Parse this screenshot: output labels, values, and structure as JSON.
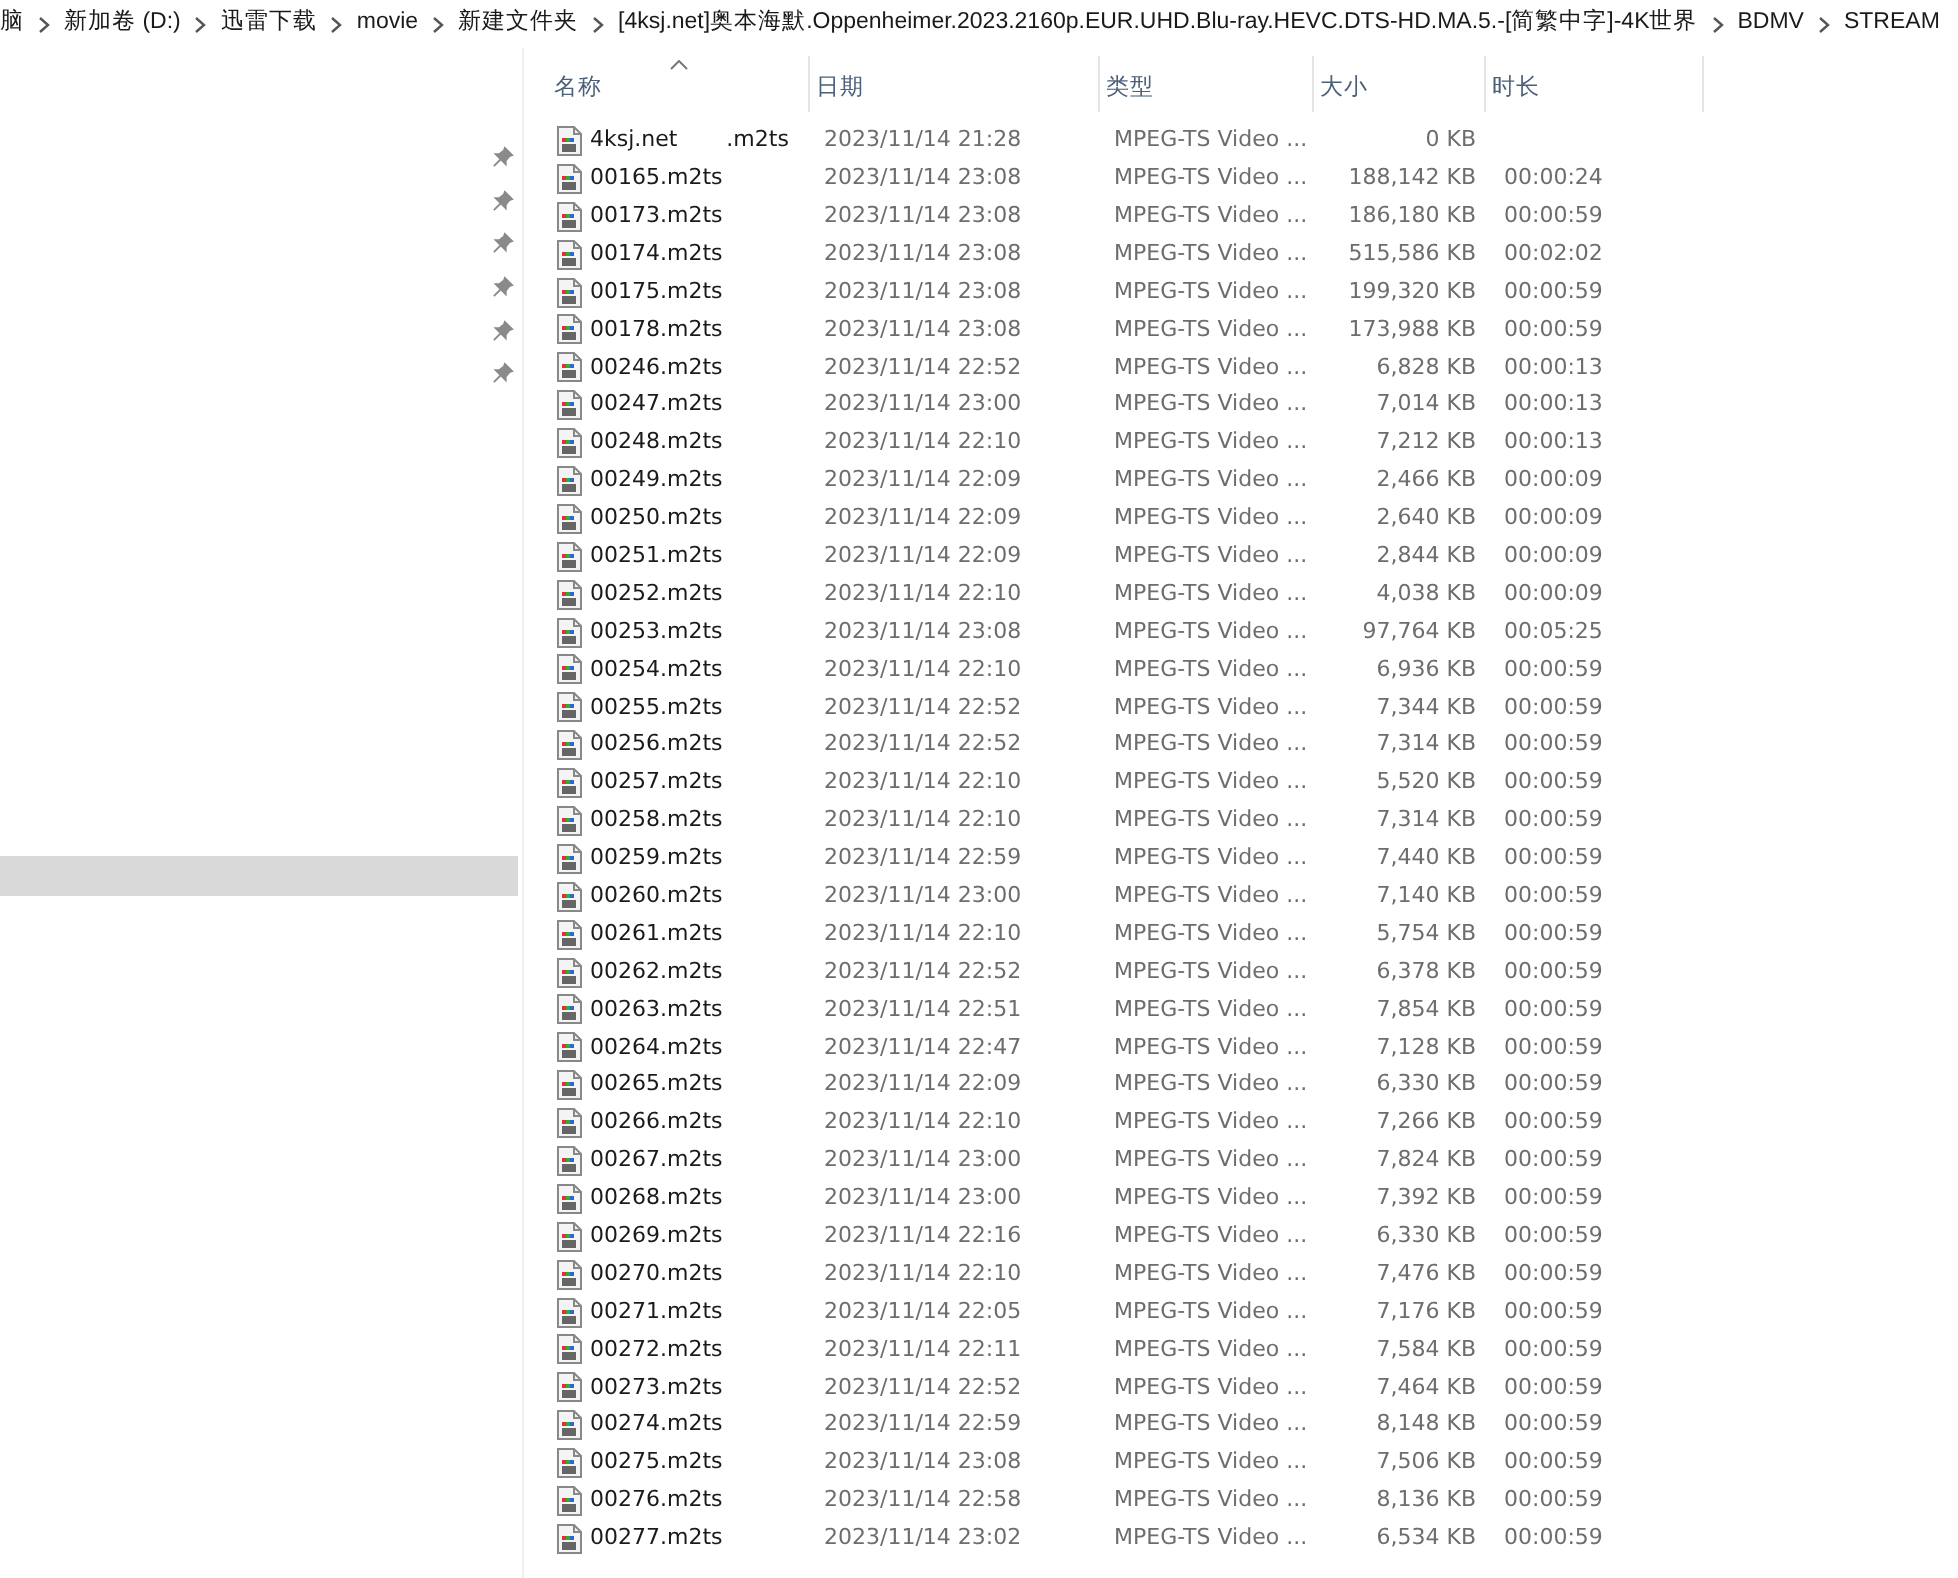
{
  "breadcrumb": [
    "脑",
    "新加卷 (D:)",
    "迅雷下载",
    "movie",
    "新建文件夹",
    "[4ksj.net]奥本海默.Oppenheimer.2023.2160p.EUR.UHD.Blu-ray.HEVC.DTS-HD.MA.5.-[简繁中字]-4K世界",
    "BDMV",
    "STREAM"
  ],
  "sidebar": {
    "items": [
      {
        "pinned": true
      },
      {
        "pinned": true
      },
      {
        "pinned": true
      },
      {
        "pinned": true
      },
      {
        "pinned": true
      },
      {
        "pinned": true
      }
    ]
  },
  "columns": [
    {
      "label": "名称",
      "sorted": true
    },
    {
      "label": "日期",
      "sorted": false
    },
    {
      "label": "类型",
      "sorted": false
    },
    {
      "label": "大小",
      "sorted": false
    },
    {
      "label": "时长",
      "sorted": false
    }
  ],
  "rows": [
    {
      "name": "4ksj.net       .m2ts",
      "date": "2023/11/14 21:28",
      "type": "MPEG-TS Video ...",
      "size": "0 KB"
    },
    {
      "name": "00165.m2ts",
      "date": "2023/11/14 23:08",
      "type": "MPEG-TS Video ...",
      "size": "188,142 KB",
      "duration": "00:00:24"
    },
    {
      "name": "00173.m2ts",
      "date": "2023/11/14 23:08",
      "type": "MPEG-TS Video ...",
      "size": "186,180 KB",
      "duration": "00:00:59"
    },
    {
      "name": "00174.m2ts",
      "date": "2023/11/14 23:08",
      "type": "MPEG-TS Video ...",
      "size": "515,586 KB",
      "duration": "00:02:02"
    },
    {
      "name": "00175.m2ts",
      "date": "2023/11/14 23:08",
      "type": "MPEG-TS Video ...",
      "size": "199,320 KB",
      "duration": "00:00:59"
    },
    {
      "name": "00178.m2ts",
      "date": "2023/11/14 23:08",
      "type": "MPEG-TS Video ...",
      "size": "173,988 KB",
      "duration": "00:00:59"
    },
    {
      "name": "00246.m2ts",
      "date": "2023/11/14 22:52",
      "type": "MPEG-TS Video ...",
      "size": "6,828 KB",
      "duration": "00:00:13"
    },
    {
      "name": "00247.m2ts",
      "date": "2023/11/14 23:00",
      "type": "MPEG-TS Video ...",
      "size": "7,014 KB",
      "duration": "00:00:13"
    },
    {
      "name": "00248.m2ts",
      "date": "2023/11/14 22:10",
      "type": "MPEG-TS Video ...",
      "size": "7,212 KB",
      "duration": "00:00:13"
    },
    {
      "name": "00249.m2ts",
      "date": "2023/11/14 22:09",
      "type": "MPEG-TS Video ...",
      "size": "2,466 KB",
      "duration": "00:00:09"
    },
    {
      "name": "00250.m2ts",
      "date": "2023/11/14 22:09",
      "type": "MPEG-TS Video ...",
      "size": "2,640 KB",
      "duration": "00:00:09"
    },
    {
      "name": "00251.m2ts",
      "date": "2023/11/14 22:09",
      "type": "MPEG-TS Video ...",
      "size": "2,844 KB",
      "duration": "00:00:09"
    },
    {
      "name": "00252.m2ts",
      "date": "2023/11/14 22:10",
      "type": "MPEG-TS Video ...",
      "size": "4,038 KB",
      "duration": "00:00:09"
    },
    {
      "name": "00253.m2ts",
      "date": "2023/11/14 23:08",
      "type": "MPEG-TS Video ...",
      "size": "97,764 KB",
      "duration": "00:05:25"
    },
    {
      "name": "00254.m2ts",
      "date": "2023/11/14 22:10",
      "type": "MPEG-TS Video ...",
      "size": "6,936 KB",
      "duration": "00:00:59"
    },
    {
      "name": "00255.m2ts",
      "date": "2023/11/14 22:52",
      "type": "MPEG-TS Video ...",
      "size": "7,344 KB",
      "duration": "00:00:59"
    },
    {
      "name": "00256.m2ts",
      "date": "2023/11/14 22:52",
      "type": "MPEG-TS Video ...",
      "size": "7,314 KB",
      "duration": "00:00:59"
    },
    {
      "name": "00257.m2ts",
      "date": "2023/11/14 22:10",
      "type": "MPEG-TS Video ...",
      "size": "5,520 KB",
      "duration": "00:00:59"
    },
    {
      "name": "00258.m2ts",
      "date": "2023/11/14 22:10",
      "type": "MPEG-TS Video ...",
      "size": "7,314 KB",
      "duration": "00:00:59"
    },
    {
      "name": "00259.m2ts",
      "date": "2023/11/14 22:59",
      "type": "MPEG-TS Video ...",
      "size": "7,440 KB",
      "duration": "00:00:59"
    },
    {
      "name": "00260.m2ts",
      "date": "2023/11/14 23:00",
      "type": "MPEG-TS Video ...",
      "size": "7,140 KB",
      "duration": "00:00:59"
    },
    {
      "name": "00261.m2ts",
      "date": "2023/11/14 22:10",
      "type": "MPEG-TS Video ...",
      "size": "5,754 KB",
      "duration": "00:00:59"
    },
    {
      "name": "00262.m2ts",
      "date": "2023/11/14 22:52",
      "type": "MPEG-TS Video ...",
      "size": "6,378 KB",
      "duration": "00:00:59"
    },
    {
      "name": "00263.m2ts",
      "date": "2023/11/14 22:51",
      "type": "MPEG-TS Video ...",
      "size": "7,854 KB",
      "duration": "00:00:59"
    },
    {
      "name": "00264.m2ts",
      "date": "2023/11/14 22:47",
      "type": "MPEG-TS Video ...",
      "size": "7,128 KB",
      "duration": "00:00:59"
    },
    {
      "name": "00265.m2ts",
      "date": "2023/11/14 22:09",
      "type": "MPEG-TS Video ...",
      "size": "6,330 KB",
      "duration": "00:00:59"
    },
    {
      "name": "00266.m2ts",
      "date": "2023/11/14 22:10",
      "type": "MPEG-TS Video ...",
      "size": "7,266 KB",
      "duration": "00:00:59"
    },
    {
      "name": "00267.m2ts",
      "date": "2023/11/14 23:00",
      "type": "MPEG-TS Video ...",
      "size": "7,824 KB",
      "duration": "00:00:59"
    },
    {
      "name": "00268.m2ts",
      "date": "2023/11/14 23:00",
      "type": "MPEG-TS Video ...",
      "size": "7,392 KB",
      "duration": "00:00:59"
    },
    {
      "name": "00269.m2ts",
      "date": "2023/11/14 22:16",
      "type": "MPEG-TS Video ...",
      "size": "6,330 KB",
      "duration": "00:00:59"
    },
    {
      "name": "00270.m2ts",
      "date": "2023/11/14 22:10",
      "type": "MPEG-TS Video ...",
      "size": "7,476 KB",
      "duration": "00:00:59"
    },
    {
      "name": "00271.m2ts",
      "date": "2023/11/14 22:05",
      "type": "MPEG-TS Video ...",
      "size": "7,176 KB",
      "duration": "00:00:59"
    },
    {
      "name": "00272.m2ts",
      "date": "2023/11/14 22:11",
      "type": "MPEG-TS Video ...",
      "size": "7,584 KB",
      "duration": "00:00:59"
    },
    {
      "name": "00273.m2ts",
      "date": "2023/11/14 22:52",
      "type": "MPEG-TS Video ...",
      "size": "7,464 KB",
      "duration": "00:00:59"
    },
    {
      "name": "00274.m2ts",
      "date": "2023/11/14 22:59",
      "type": "MPEG-TS Video ...",
      "size": "8,148 KB",
      "duration": "00:00:59"
    },
    {
      "name": "00275.m2ts",
      "date": "2023/11/14 23:08",
      "type": "MPEG-TS Video ...",
      "size": "7,506 KB",
      "duration": "00:00:59"
    },
    {
      "name": "00276.m2ts",
      "date": "2023/11/14 22:58",
      "type": "MPEG-TS Video ...",
      "size": "8,136 KB",
      "duration": "00:00:59"
    },
    {
      "name": "00277.m2ts",
      "date": "2023/11/14 23:02",
      "type": "MPEG-TS Video ...",
      "size": "6,534 KB",
      "duration": "00:00:59"
    }
  ]
}
